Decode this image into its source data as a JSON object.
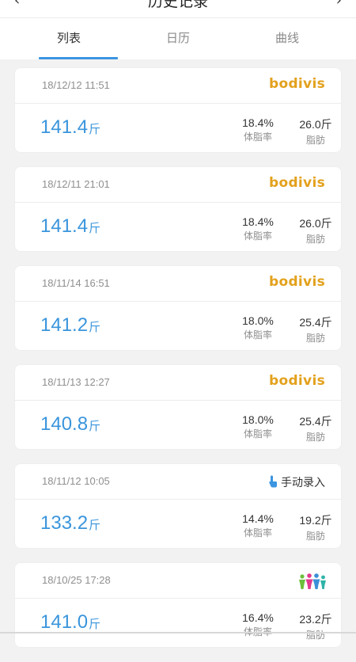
{
  "header": {
    "title": "历史记录",
    "back_glyph": "‹",
    "right_glyph": "›"
  },
  "tabs": [
    {
      "label": "列表",
      "active": true
    },
    {
      "label": "日历",
      "active": false
    },
    {
      "label": "曲线",
      "active": false
    }
  ],
  "colors": {
    "accent": "#3b95e0",
    "weight_text": "#3a95dc",
    "brand_bodivis": "#e3a11c"
  },
  "records": [
    {
      "datetime": "18/12/12 11:51",
      "source_type": "brand",
      "source_label": "bodivis",
      "weight": "141.4",
      "weight_unit": "斤",
      "fat_rate": "18.4%",
      "fat_rate_label": "体脂率",
      "fat_mass": "26.0斤",
      "fat_mass_label": "脂肪"
    },
    {
      "datetime": "18/12/11 21:01",
      "source_type": "brand",
      "source_label": "bodivis",
      "weight": "141.4",
      "weight_unit": "斤",
      "fat_rate": "18.4%",
      "fat_rate_label": "体脂率",
      "fat_mass": "26.0斤",
      "fat_mass_label": "脂肪"
    },
    {
      "datetime": "18/11/14 16:51",
      "source_type": "brand",
      "source_label": "bodivis",
      "weight": "141.2",
      "weight_unit": "斤",
      "fat_rate": "18.0%",
      "fat_rate_label": "体脂率",
      "fat_mass": "25.4斤",
      "fat_mass_label": "脂肪"
    },
    {
      "datetime": "18/11/13 12:27",
      "source_type": "brand",
      "source_label": "bodivis",
      "weight": "140.8",
      "weight_unit": "斤",
      "fat_rate": "18.0%",
      "fat_rate_label": "体脂率",
      "fat_mass": "25.4斤",
      "fat_mass_label": "脂肪"
    },
    {
      "datetime": "18/11/12 10:05",
      "source_type": "manual",
      "source_label": "手动录入",
      "source_icon": "pointing-hand-icon",
      "weight": "133.2",
      "weight_unit": "斤",
      "fat_rate": "14.4%",
      "fat_rate_label": "体脂率",
      "fat_mass": "19.2斤",
      "fat_mass_label": "脂肪"
    },
    {
      "datetime": "18/10/25 17:28",
      "source_type": "people",
      "source_icon": "family-people-icon",
      "weight": "141.0",
      "weight_unit": "斤",
      "fat_rate": "16.4%",
      "fat_rate_label": "体脂率",
      "fat_mass": "23.2斤",
      "fat_mass_label": "脂肪"
    }
  ]
}
